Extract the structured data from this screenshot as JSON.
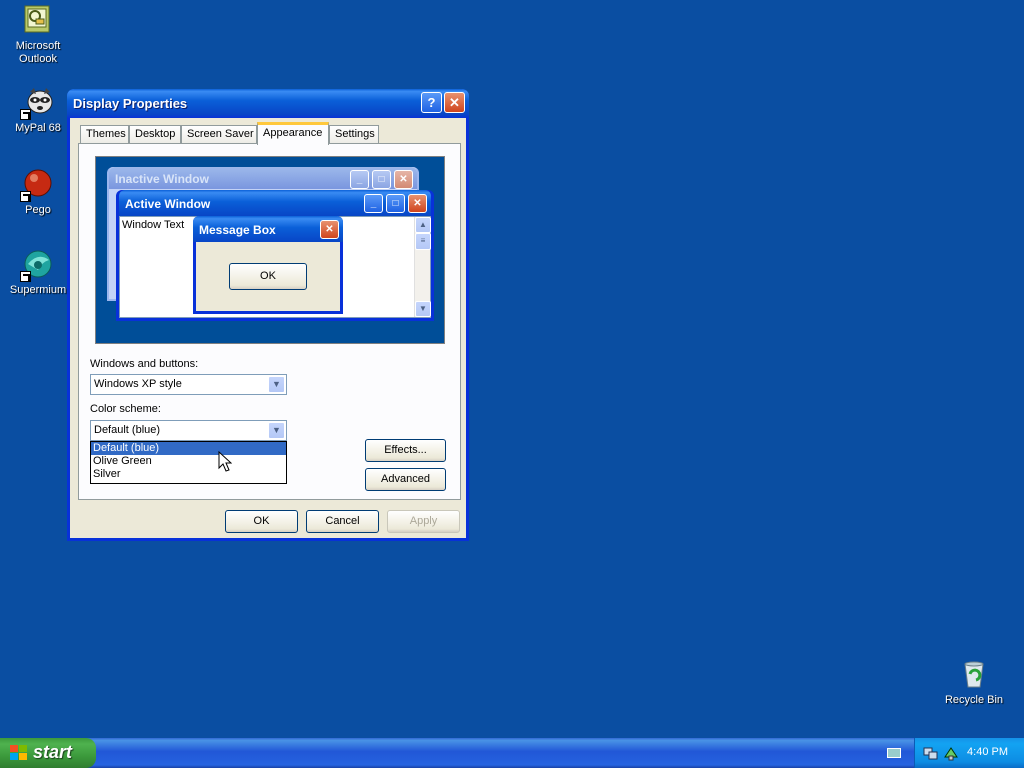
{
  "desktop": {
    "icons": [
      {
        "label": "Microsoft Outlook"
      },
      {
        "label": "MyPal 68"
      },
      {
        "label": "Pego"
      },
      {
        "label": "Supermium"
      },
      {
        "label": "Recycle Bin"
      }
    ]
  },
  "window": {
    "title": "Display Properties",
    "help_glyph": "?",
    "close_glyph": "✕",
    "tabs": [
      "Themes",
      "Desktop",
      "Screen Saver",
      "Appearance",
      "Settings"
    ],
    "active_tab": "Appearance",
    "preview": {
      "inactive_title": "Inactive Window",
      "active_title": "Active Window",
      "window_text": "Window Text",
      "msgbox_title": "Message Box",
      "msgbox_ok": "OK"
    },
    "windows_buttons_label": "Windows and buttons:",
    "windows_buttons_value": "Windows XP style",
    "color_scheme_label": "Color scheme:",
    "color_scheme_value": "Default (blue)",
    "color_scheme_options": [
      "Default (blue)",
      "Olive Green",
      "Silver"
    ],
    "effects_button": "Effects...",
    "advanced_button": "Advanced",
    "ok_button": "OK",
    "cancel_button": "Cancel",
    "apply_button": "Apply"
  },
  "taskbar": {
    "start_label": "start",
    "clock": "4:40 PM"
  },
  "colors": {
    "desktop": "#0a4ea2",
    "selection": "#316ac5"
  }
}
